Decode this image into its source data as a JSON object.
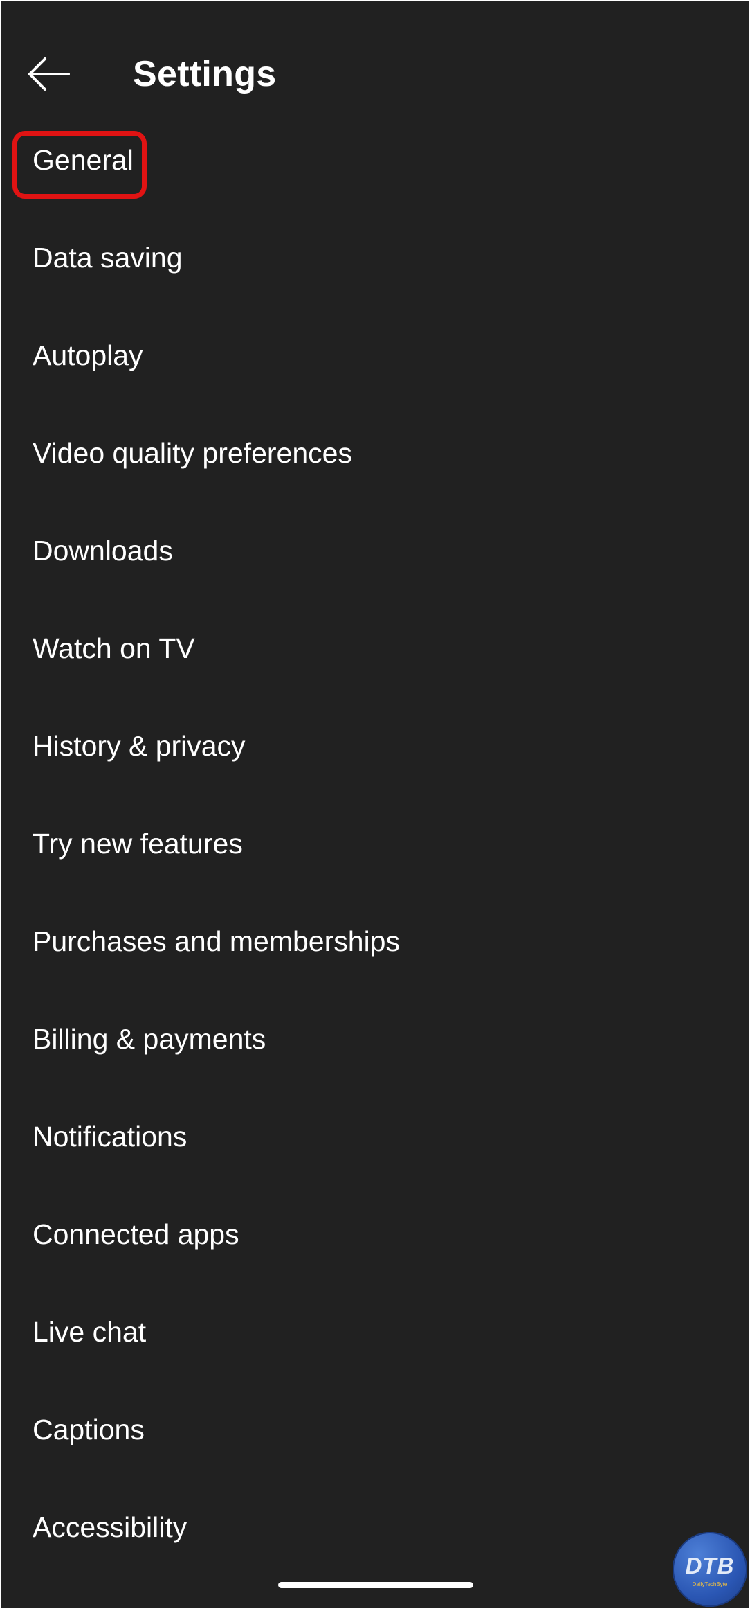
{
  "header": {
    "title": "Settings",
    "back_icon": "arrow-left-icon"
  },
  "settings": {
    "items": [
      {
        "label": "General",
        "highlighted": true
      },
      {
        "label": "Data saving"
      },
      {
        "label": "Autoplay"
      },
      {
        "label": "Video quality preferences"
      },
      {
        "label": "Downloads"
      },
      {
        "label": "Watch on TV"
      },
      {
        "label": "History & privacy"
      },
      {
        "label": "Try new features"
      },
      {
        "label": "Purchases and memberships"
      },
      {
        "label": "Billing & payments"
      },
      {
        "label": "Notifications"
      },
      {
        "label": "Connected apps"
      },
      {
        "label": "Live chat"
      },
      {
        "label": "Captions"
      },
      {
        "label": "Accessibility"
      }
    ]
  },
  "watermark": {
    "text": "DTB",
    "subtext": "DailyTechByte"
  },
  "colors": {
    "background": "#212121",
    "text": "#ffffff",
    "highlight": "#e01313",
    "watermark": "#2a56b3"
  }
}
